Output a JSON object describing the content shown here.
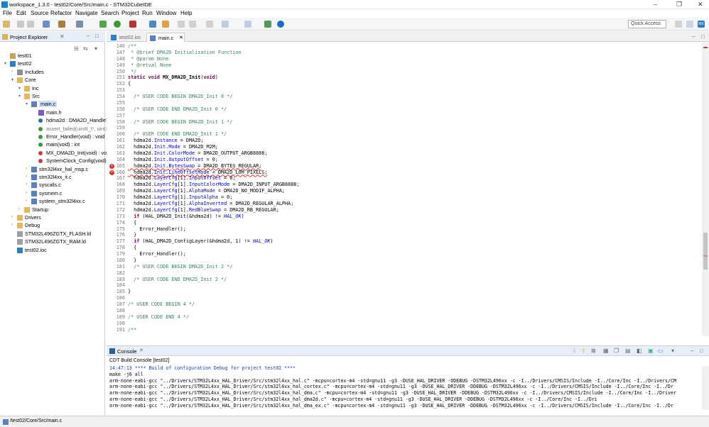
{
  "window": {
    "title": "workspace_1.3.0 - test02/Core/Src/main.c - STM32CubeIDE"
  },
  "menu": [
    "File",
    "Edit",
    "Source",
    "Refactor",
    "Navigate",
    "Search",
    "Project",
    "Run",
    "Window",
    "Help"
  ],
  "toolbar": {
    "quick_access": "Quick Access",
    "perspective": "MX"
  },
  "project_explorer": {
    "title": "Project Explorer",
    "items": [
      {
        "label": "test01",
        "indent": 0,
        "icon": "project-icon"
      },
      {
        "label": "test02",
        "indent": 0,
        "icon": "ide-project-icon"
      },
      {
        "label": "Includes",
        "indent": 1,
        "icon": "includes-icon"
      },
      {
        "label": "Core",
        "indent": 1,
        "icon": "folder-icon"
      },
      {
        "label": "Inc",
        "indent": 2,
        "icon": "folder-icon"
      },
      {
        "label": "Src",
        "indent": 2,
        "icon": "folder-icon"
      },
      {
        "label": "main.c",
        "indent": 3,
        "icon": "c-file-icon"
      },
      {
        "label": "main.h",
        "indent": 4,
        "icon": "header-icon"
      },
      {
        "label": "hdma2d : DMA2D_HandleT",
        "indent": 4,
        "icon": "variable-icon"
      },
      {
        "label": "assert_failed(uint8_t*, uint3",
        "indent": 4,
        "icon": "function-icon",
        "grey": true
      },
      {
        "label": "Error_Handler(void) : void",
        "indent": 4,
        "icon": "function-icon"
      },
      {
        "label": "main(void) : int",
        "indent": 4,
        "icon": "function-icon"
      },
      {
        "label": "MX_DMA2D_Init(void) : voi",
        "indent": 4,
        "icon": "static-function-icon"
      },
      {
        "label": "SystemClock_Config(void)",
        "indent": 4,
        "icon": "static-function-icon"
      },
      {
        "label": "stm32l4xx_hal_msp.c",
        "indent": 3,
        "icon": "c-file-icon"
      },
      {
        "label": "stm32l4xx_it.c",
        "indent": 3,
        "icon": "c-file-icon"
      },
      {
        "label": "syscalls.c",
        "indent": 3,
        "icon": "c-file-icon"
      },
      {
        "label": "sysmem.c",
        "indent": 3,
        "icon": "c-file-icon"
      },
      {
        "label": "system_stm32l4xx.c",
        "indent": 3,
        "icon": "c-file-icon"
      },
      {
        "label": "Startup",
        "indent": 2,
        "icon": "folder-icon"
      },
      {
        "label": "Drivers",
        "indent": 1,
        "icon": "folder-icon"
      },
      {
        "label": "Debug",
        "indent": 1,
        "icon": "folder-icon"
      },
      {
        "label": "STM32L496ZGTX_FLASH.ld",
        "indent": 1,
        "icon": "ld-file-icon"
      },
      {
        "label": "STM32L496ZGTX_RAM.ld",
        "indent": 1,
        "icon": "ld-file-icon"
      },
      {
        "label": "test02.ioc",
        "indent": 1,
        "icon": "ioc-file-icon"
      }
    ]
  },
  "editor": {
    "tabs": [
      {
        "label": "test02.ioc",
        "active": false
      },
      {
        "label": "main.c",
        "active": true
      }
    ],
    "lines": [
      {
        "n": "146",
        "code": "/**",
        "cls": "cm"
      },
      {
        "n": "147",
        "code": " * @brief DMA2D Initialization Function",
        "cls": "cm"
      },
      {
        "n": "148",
        "code": " * @param None",
        "cls": "cm"
      },
      {
        "n": "149",
        "code": " * @retval None",
        "cls": "cm"
      },
      {
        "n": "150",
        "code": " */",
        "cls": "cm"
      },
      {
        "n": "151",
        "code": "static void MX_DMA2D_Init(void)",
        "cls": "kwline"
      },
      {
        "n": "152",
        "code": "{",
        "cls": ""
      },
      {
        "n": "153",
        "code": "",
        "cls": ""
      },
      {
        "n": "154",
        "code": "  /* USER CODE BEGIN DMA2D_Init 0 */",
        "cls": "cm"
      },
      {
        "n": "155",
        "code": "",
        "cls": ""
      },
      {
        "n": "156",
        "code": "  /* USER CODE END DMA2D_Init 0 */",
        "cls": "cm"
      },
      {
        "n": "157",
        "code": "",
        "cls": ""
      },
      {
        "n": "158",
        "code": "  /* USER CODE BEGIN DMA2D_Init 1 */",
        "cls": "cm"
      },
      {
        "n": "159",
        "code": "",
        "cls": ""
      },
      {
        "n": "160",
        "code": "  /* USER CODE END DMA2D_Init 1 */",
        "cls": "cm"
      },
      {
        "n": "161",
        "code": "  hdma2d.Instance = DMA2D;",
        "cls": ""
      },
      {
        "n": "162",
        "code": "  hdma2d.Init.Mode = DMA2D_M2M;",
        "cls": ""
      },
      {
        "n": "163",
        "code": "  hdma2d.Init.ColorMode = DMA2D_OUTPUT_ARGB8888;",
        "cls": ""
      },
      {
        "n": "164",
        "code": "  hdma2d.Init.OutputOffset = 0;",
        "cls": ""
      },
      {
        "n": "165",
        "code": "  hdma2d.Init.BytesSwap = DMA2D_BYTES_REGULAR;",
        "cls": "error"
      },
      {
        "n": "166",
        "code": "  hdma2d.Init.LineOffsetMode = DMA2D_LOM_PIXELS;",
        "cls": "error"
      },
      {
        "n": "167",
        "code": "  hdma2d.LayerCfg[1].InputOffset = 0;",
        "cls": ""
      },
      {
        "n": "168",
        "code": "  hdma2d.LayerCfg[1].InputColorMode = DMA2D_INPUT_ARGB8888;",
        "cls": ""
      },
      {
        "n": "169",
        "code": "  hdma2d.LayerCfg[1].AlphaMode = DMA2D_NO_MODIF_ALPHA;",
        "cls": ""
      },
      {
        "n": "170",
        "code": "  hdma2d.LayerCfg[1].InputAlpha = 0;",
        "cls": ""
      },
      {
        "n": "171",
        "code": "  hdma2d.LayerCfg[1].AlphaInverted = DMA2D_REGULAR_ALPHA;",
        "cls": ""
      },
      {
        "n": "172",
        "code": "  hdma2d.LayerCfg[1].RedBlueSwap = DMA2D_RB_REGULAR;",
        "cls": ""
      },
      {
        "n": "173",
        "code": "  if (HAL_DMA2D_Init(&hdma2d) != HAL_OK)",
        "cls": "ifline"
      },
      {
        "n": "174",
        "code": "  {",
        "cls": ""
      },
      {
        "n": "175",
        "code": "    Error_Handler();",
        "cls": ""
      },
      {
        "n": "176",
        "code": "  }",
        "cls": ""
      },
      {
        "n": "177",
        "code": "  if (HAL_DMA2D_ConfigLayer(&hdma2d, 1) != HAL_OK)",
        "cls": "ifline"
      },
      {
        "n": "178",
        "code": "  {",
        "cls": ""
      },
      {
        "n": "179",
        "code": "    Error_Handler();",
        "cls": ""
      },
      {
        "n": "180",
        "code": "  }",
        "cls": ""
      },
      {
        "n": "181",
        "code": "  /* USER CODE BEGIN DMA2D_Init 2 */",
        "cls": "cm"
      },
      {
        "n": "182",
        "code": "",
        "cls": ""
      },
      {
        "n": "183",
        "code": "  /* USER CODE END DMA2D_Init 2 */",
        "cls": "cm"
      },
      {
        "n": "184",
        "code": "",
        "cls": ""
      },
      {
        "n": "185",
        "code": "}",
        "cls": ""
      },
      {
        "n": "186",
        "code": "",
        "cls": ""
      },
      {
        "n": "187",
        "code": "/* USER CODE BEGIN 4 */",
        "cls": "cm"
      },
      {
        "n": "188",
        "code": "",
        "cls": ""
      },
      {
        "n": "189",
        "code": "/* USER CODE END 4 */",
        "cls": "cm"
      },
      {
        "n": "190",
        "code": "",
        "cls": ""
      },
      {
        "n": "191",
        "code": "/**",
        "cls": "cm"
      }
    ]
  },
  "console": {
    "tab": "Console",
    "header": "CDT Build Console [test02]",
    "lines": [
      "14:47:13 **** Build of configuration Debug for project test02 ****",
      "make -j6 all",
      "arm-none-eabi-gcc \"../Drivers/STM32L4xx_HAL_Driver/Src/stm32l4xx_hal.c\" -mcpu=cortex-m4 -std=gnu11 -g3 -DUSE_HAL_DRIVER -DDEBUG -DSTM32L496xx -c -I../Drivers/CMSIS/Include -I../Core/Inc -I../Drivers/CM",
      "arm-none-eabi-gcc \"../Drivers/STM32L4xx_HAL_Driver/Src/stm32l4xx_hal_cortex.c\" -mcpu=cortex-m4 -std=gnu11 -g3 -DUSE_HAL_DRIVER -DDEBUG -DSTM32L496xx -c -I../Drivers/CMSIS/Include -I../Core/Inc -I../Dr",
      "arm-none-eabi-gcc \"../Drivers/STM32L4xx_HAL_Driver/Src/stm32l4xx_hal_dma.c\" -mcpu=cortex-m4 -std=gnu11 -g3 -DUSE_HAL_DRIVER -DDEBUG -DSTM32L496xx -c -I../Drivers/CMSIS/Include -I../Core/Inc -I../Driver",
      "arm-none-eabi-gcc \"../Drivers/STM32L4xx_HAL_Driver/Src/stm32l4xx_hal_dma2d.c\" -mcpu=cortex-m4 -std=gnu11 -g3 -DUSE_HAL_DRIVER -DDEBUG -DSTM32L496xx -c -I../Core/Inc -I../Dri",
      "arm-none-eabi-gcc \"../Drivers/STM32L4xx_HAL_Driver/Src/stm32l4xx_hal_dma_ex.c\" -mcpu=cortex-m4 -std=gnu11 -g3 -DUSE_HAL_DRIVER -DDEBUG -DSTM32L496xx -c -I../Drivers/CMSIS/Include -I../Core/Inc -I../Dr"
    ]
  },
  "statusbar": {
    "path": "/test02/Core/Src/main.c"
  }
}
